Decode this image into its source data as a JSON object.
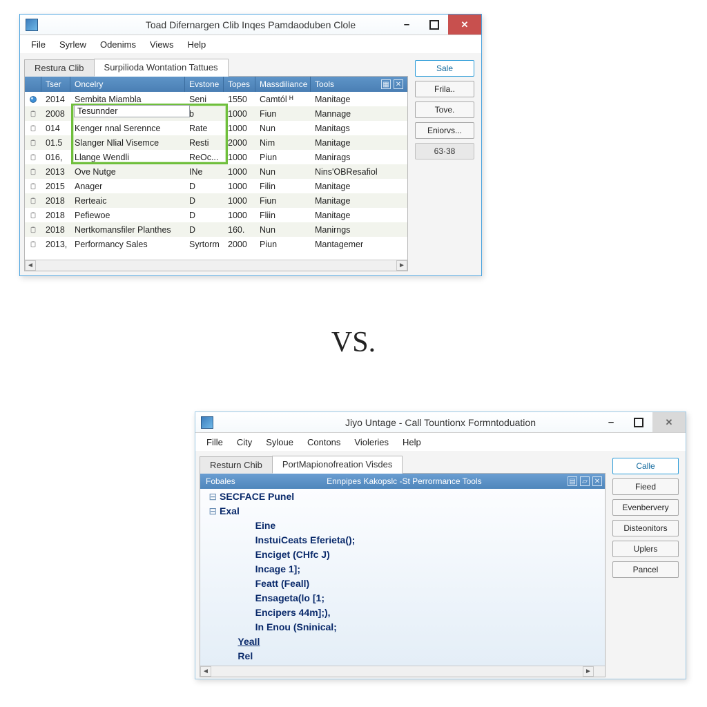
{
  "vs_label": "VS.",
  "top": {
    "title": "Toad Difernargen Clib Inqes Pamdaoduben Clole",
    "menu": [
      "File",
      "Syrlew",
      "Odenims",
      "Views",
      "Help"
    ],
    "tabs": [
      {
        "label": "Restura Clib",
        "active": false
      },
      {
        "label": "Surpilioda Wontation Tattues",
        "active": true
      }
    ],
    "right_buttons": [
      {
        "label": "Sale",
        "kind": "primary"
      },
      {
        "label": "Frila..",
        "kind": "normal"
      },
      {
        "label": "Tove.",
        "kind": "normal"
      },
      {
        "label": "Eniorvs...",
        "kind": "normal"
      },
      {
        "label": "63·38",
        "kind": "readout"
      }
    ],
    "grid": {
      "columns": [
        "Tser",
        "Oncelry",
        "Evstone",
        "Topes",
        "Massdiliance",
        "Tools"
      ],
      "rows": [
        {
          "icon": "orb",
          "tser": "2014",
          "once": "Sembita Miambla",
          "ev": "Seni",
          "top": "1550",
          "mass": "Camtól   ᴴ",
          "tools": "Manitage"
        },
        {
          "icon": "clip",
          "tser": "2008",
          "once": "Tesunnder",
          "ev": "b",
          "top": "1000",
          "mass": "Fiun",
          "tools": "Mannage"
        },
        {
          "icon": "clip",
          "tser": "014",
          "once": "Kenger nnal Serennce",
          "ev": "Rate",
          "top": "1000",
          "mass": "Nun",
          "tools": "Manitags"
        },
        {
          "icon": "clip",
          "tser": "01.5",
          "once": "Slanger Nlial Visemce",
          "ev": "Resti",
          "top": "2000",
          "mass": "Nim",
          "tools": "Manitage"
        },
        {
          "icon": "clip",
          "tser": "016,",
          "once": "Llange Wendli",
          "ev": "ReOc...",
          "top": "1000",
          "mass": "Piun",
          "tools": "Manirags"
        },
        {
          "icon": "clip",
          "tser": "2013",
          "once": "Ove Nutge",
          "ev": "INe",
          "top": "1000",
          "mass": "Nun",
          "tools": "Nins'OBResafiol"
        },
        {
          "icon": "clip",
          "tser": "2015",
          "once": "Anager",
          "ev": "D",
          "top": "1000",
          "mass": "Filin",
          "tools": "Manitage"
        },
        {
          "icon": "clip",
          "tser": "2018",
          "once": "Rerteaic",
          "ev": "D",
          "top": "1000",
          "mass": "Fiun",
          "tools": "Manitage"
        },
        {
          "icon": "clip",
          "tser": "2018",
          "once": "Pefiewoe",
          "ev": "D",
          "top": "1000",
          "mass": "Fliin",
          "tools": "Manitage"
        },
        {
          "icon": "clip",
          "tser": "2018",
          "once": "Nertkomansfiler Planthes",
          "ev": "D",
          "top": "160.",
          "mass": "Nun",
          "tools": "Manirngs"
        },
        {
          "icon": "clip",
          "tser": "2013,",
          "once": "Performancy Sales",
          "ev": "Syrtorm",
          "top": "2000",
          "mass": "Piun",
          "tools": "Mantagemer"
        }
      ]
    },
    "inline_edit": "Tesunnder"
  },
  "bottom": {
    "title": "Jiyo Untage - Call Tountionx Formntoduation",
    "menu": [
      "Fille",
      "City",
      "Syloue",
      "Contons",
      "Violeries",
      "Help"
    ],
    "tabs": [
      {
        "label": "Resturn Chib",
        "active": false
      },
      {
        "label": "PortMapionofreation Visdes",
        "active": true
      }
    ],
    "right_buttons": [
      {
        "label": "Calle",
        "kind": "primary"
      },
      {
        "label": "Fieed",
        "kind": "normal"
      },
      {
        "label": "Evenbervery",
        "kind": "normal"
      },
      {
        "label": "Disteonitors",
        "kind": "normal"
      },
      {
        "label": "Uplers",
        "kind": "normal"
      },
      {
        "label": "Pancel",
        "kind": "normal"
      }
    ],
    "code_header_left": "Fobales",
    "code_header_title": "Ennpipes Kakopslc -St Perrormance Tools",
    "code_lines": [
      {
        "indent": 0,
        "toggle": "-",
        "text": "SECFACE Punel",
        "kw": true
      },
      {
        "indent": 0,
        "toggle": "-",
        "text": "Exal",
        "kw": true
      },
      {
        "indent": 2,
        "toggle": "",
        "text": "Eine",
        "kw": true
      },
      {
        "indent": 2,
        "toggle": "",
        "text": "InstuiCeats Eferieta();",
        "kw": true
      },
      {
        "indent": 2,
        "toggle": "",
        "text": "Enciget (CHfc J)",
        "kw": true
      },
      {
        "indent": 2,
        "toggle": "",
        "text": "Incage 1];",
        "kw": true
      },
      {
        "indent": 2,
        "toggle": "",
        "text": "Featt (Feall)",
        "kw": true
      },
      {
        "indent": 2,
        "toggle": "",
        "text": "Ensageta(lo [1;",
        "kw": true
      },
      {
        "indent": 2,
        "toggle": "",
        "text": "Encipers 44m];),",
        "kw": true
      },
      {
        "indent": 2,
        "toggle": "",
        "text": "In Enou (Sninical;",
        "kw": true
      },
      {
        "indent": 1,
        "toggle": "",
        "text": "YeaIl",
        "kw": true,
        "underline": true
      },
      {
        "indent": 1,
        "toggle": "",
        "text": "Rel",
        "kw": true
      }
    ]
  }
}
